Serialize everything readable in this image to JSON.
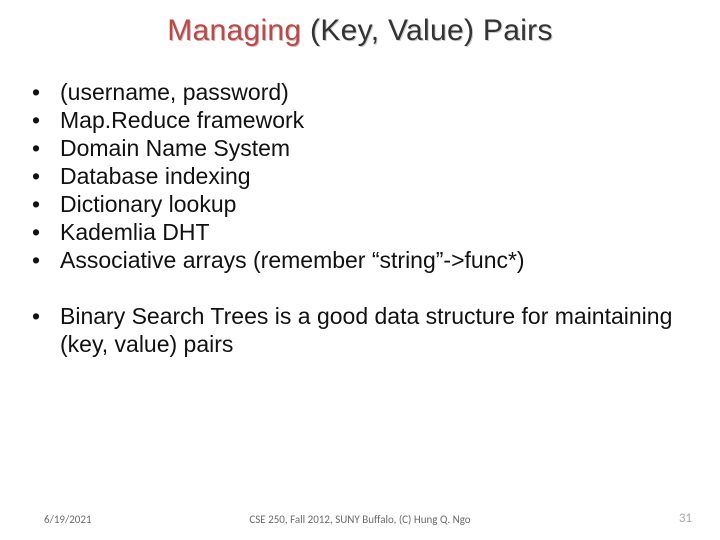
{
  "title": {
    "left": "Managing ",
    "right": "(Key, Value) Pairs"
  },
  "bullets": [
    "(username, password)",
    "Map.Reduce framework",
    "Domain Name System",
    "Database indexing",
    "Dictionary lookup",
    "Kademlia DHT",
    "Associative arrays (remember “string”->func*)"
  ],
  "summary": "Binary Search Trees is a good data structure for maintaining (key, value) pairs",
  "footer": {
    "date": "6/19/2021",
    "course": "CSE 250, Fall 2012, SUNY Buffalo, (C) Hung Q. Ngo",
    "page": "31"
  },
  "bullet_char": "•"
}
